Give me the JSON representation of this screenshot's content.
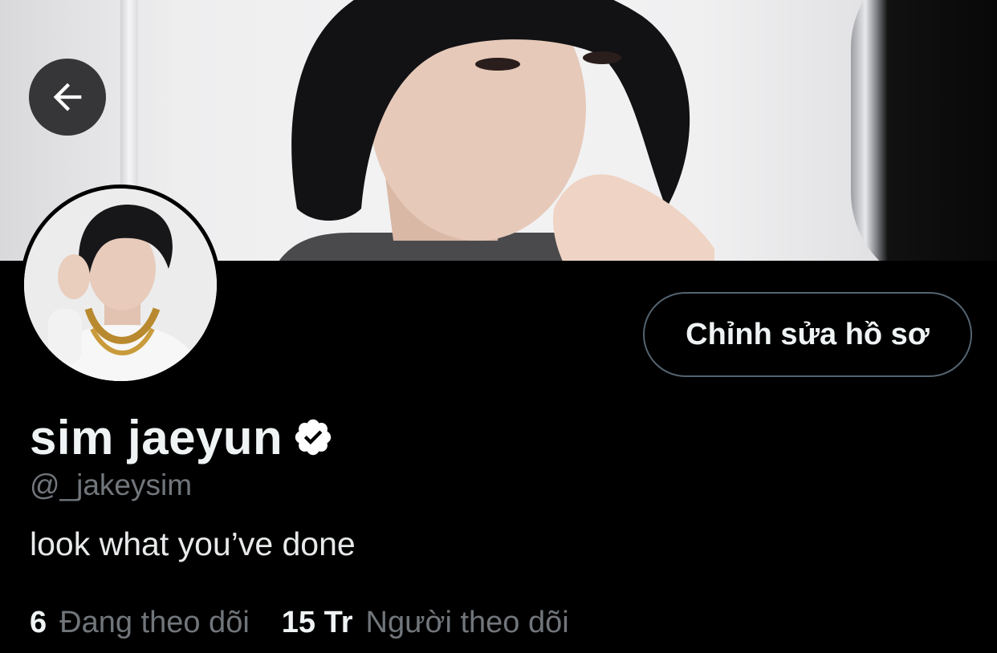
{
  "profile": {
    "display_name": "sim jaeyun",
    "handle": "@_jakeysim",
    "bio": "look what you’ve done",
    "verified": true,
    "edit_button_label": "Chỉnh sửa hồ sơ"
  },
  "stats": {
    "following_count": "6",
    "following_label": "Đang theo dõi",
    "followers_count": "15 Tr",
    "followers_label": "Người theo dõi"
  },
  "icons": {
    "back": "arrow-left-icon",
    "verified": "verified-badge-icon"
  },
  "colors": {
    "background": "#000000",
    "primary_text": "#eff3f4",
    "secondary_text": "#71767b",
    "button_border": "#536471"
  }
}
